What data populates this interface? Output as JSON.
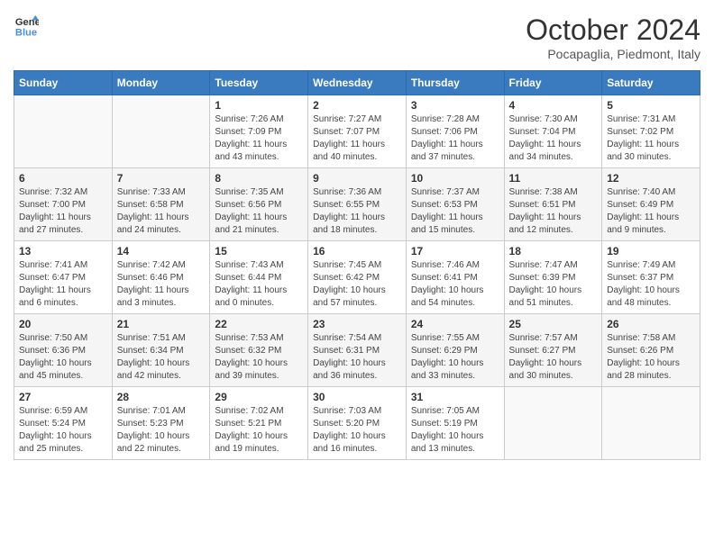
{
  "header": {
    "logo": {
      "line1": "General",
      "line2": "Blue"
    },
    "title": "October 2024",
    "location": "Pocapaglia, Piedmont, Italy"
  },
  "days_of_week": [
    "Sunday",
    "Monday",
    "Tuesday",
    "Wednesday",
    "Thursday",
    "Friday",
    "Saturday"
  ],
  "weeks": [
    [
      {
        "day": "",
        "sunrise": "",
        "sunset": "",
        "daylight": ""
      },
      {
        "day": "",
        "sunrise": "",
        "sunset": "",
        "daylight": ""
      },
      {
        "day": "1",
        "sunrise": "Sunrise: 7:26 AM",
        "sunset": "Sunset: 7:09 PM",
        "daylight": "Daylight: 11 hours and 43 minutes."
      },
      {
        "day": "2",
        "sunrise": "Sunrise: 7:27 AM",
        "sunset": "Sunset: 7:07 PM",
        "daylight": "Daylight: 11 hours and 40 minutes."
      },
      {
        "day": "3",
        "sunrise": "Sunrise: 7:28 AM",
        "sunset": "Sunset: 7:06 PM",
        "daylight": "Daylight: 11 hours and 37 minutes."
      },
      {
        "day": "4",
        "sunrise": "Sunrise: 7:30 AM",
        "sunset": "Sunset: 7:04 PM",
        "daylight": "Daylight: 11 hours and 34 minutes."
      },
      {
        "day": "5",
        "sunrise": "Sunrise: 7:31 AM",
        "sunset": "Sunset: 7:02 PM",
        "daylight": "Daylight: 11 hours and 30 minutes."
      }
    ],
    [
      {
        "day": "6",
        "sunrise": "Sunrise: 7:32 AM",
        "sunset": "Sunset: 7:00 PM",
        "daylight": "Daylight: 11 hours and 27 minutes."
      },
      {
        "day": "7",
        "sunrise": "Sunrise: 7:33 AM",
        "sunset": "Sunset: 6:58 PM",
        "daylight": "Daylight: 11 hours and 24 minutes."
      },
      {
        "day": "8",
        "sunrise": "Sunrise: 7:35 AM",
        "sunset": "Sunset: 6:56 PM",
        "daylight": "Daylight: 11 hours and 21 minutes."
      },
      {
        "day": "9",
        "sunrise": "Sunrise: 7:36 AM",
        "sunset": "Sunset: 6:55 PM",
        "daylight": "Daylight: 11 hours and 18 minutes."
      },
      {
        "day": "10",
        "sunrise": "Sunrise: 7:37 AM",
        "sunset": "Sunset: 6:53 PM",
        "daylight": "Daylight: 11 hours and 15 minutes."
      },
      {
        "day": "11",
        "sunrise": "Sunrise: 7:38 AM",
        "sunset": "Sunset: 6:51 PM",
        "daylight": "Daylight: 11 hours and 12 minutes."
      },
      {
        "day": "12",
        "sunrise": "Sunrise: 7:40 AM",
        "sunset": "Sunset: 6:49 PM",
        "daylight": "Daylight: 11 hours and 9 minutes."
      }
    ],
    [
      {
        "day": "13",
        "sunrise": "Sunrise: 7:41 AM",
        "sunset": "Sunset: 6:47 PM",
        "daylight": "Daylight: 11 hours and 6 minutes."
      },
      {
        "day": "14",
        "sunrise": "Sunrise: 7:42 AM",
        "sunset": "Sunset: 6:46 PM",
        "daylight": "Daylight: 11 hours and 3 minutes."
      },
      {
        "day": "15",
        "sunrise": "Sunrise: 7:43 AM",
        "sunset": "Sunset: 6:44 PM",
        "daylight": "Daylight: 11 hours and 0 minutes."
      },
      {
        "day": "16",
        "sunrise": "Sunrise: 7:45 AM",
        "sunset": "Sunset: 6:42 PM",
        "daylight": "Daylight: 10 hours and 57 minutes."
      },
      {
        "day": "17",
        "sunrise": "Sunrise: 7:46 AM",
        "sunset": "Sunset: 6:41 PM",
        "daylight": "Daylight: 10 hours and 54 minutes."
      },
      {
        "day": "18",
        "sunrise": "Sunrise: 7:47 AM",
        "sunset": "Sunset: 6:39 PM",
        "daylight": "Daylight: 10 hours and 51 minutes."
      },
      {
        "day": "19",
        "sunrise": "Sunrise: 7:49 AM",
        "sunset": "Sunset: 6:37 PM",
        "daylight": "Daylight: 10 hours and 48 minutes."
      }
    ],
    [
      {
        "day": "20",
        "sunrise": "Sunrise: 7:50 AM",
        "sunset": "Sunset: 6:36 PM",
        "daylight": "Daylight: 10 hours and 45 minutes."
      },
      {
        "day": "21",
        "sunrise": "Sunrise: 7:51 AM",
        "sunset": "Sunset: 6:34 PM",
        "daylight": "Daylight: 10 hours and 42 minutes."
      },
      {
        "day": "22",
        "sunrise": "Sunrise: 7:53 AM",
        "sunset": "Sunset: 6:32 PM",
        "daylight": "Daylight: 10 hours and 39 minutes."
      },
      {
        "day": "23",
        "sunrise": "Sunrise: 7:54 AM",
        "sunset": "Sunset: 6:31 PM",
        "daylight": "Daylight: 10 hours and 36 minutes."
      },
      {
        "day": "24",
        "sunrise": "Sunrise: 7:55 AM",
        "sunset": "Sunset: 6:29 PM",
        "daylight": "Daylight: 10 hours and 33 minutes."
      },
      {
        "day": "25",
        "sunrise": "Sunrise: 7:57 AM",
        "sunset": "Sunset: 6:27 PM",
        "daylight": "Daylight: 10 hours and 30 minutes."
      },
      {
        "day": "26",
        "sunrise": "Sunrise: 7:58 AM",
        "sunset": "Sunset: 6:26 PM",
        "daylight": "Daylight: 10 hours and 28 minutes."
      }
    ],
    [
      {
        "day": "27",
        "sunrise": "Sunrise: 6:59 AM",
        "sunset": "Sunset: 5:24 PM",
        "daylight": "Daylight: 10 hours and 25 minutes."
      },
      {
        "day": "28",
        "sunrise": "Sunrise: 7:01 AM",
        "sunset": "Sunset: 5:23 PM",
        "daylight": "Daylight: 10 hours and 22 minutes."
      },
      {
        "day": "29",
        "sunrise": "Sunrise: 7:02 AM",
        "sunset": "Sunset: 5:21 PM",
        "daylight": "Daylight: 10 hours and 19 minutes."
      },
      {
        "day": "30",
        "sunrise": "Sunrise: 7:03 AM",
        "sunset": "Sunset: 5:20 PM",
        "daylight": "Daylight: 10 hours and 16 minutes."
      },
      {
        "day": "31",
        "sunrise": "Sunrise: 7:05 AM",
        "sunset": "Sunset: 5:19 PM",
        "daylight": "Daylight: 10 hours and 13 minutes."
      },
      {
        "day": "",
        "sunrise": "",
        "sunset": "",
        "daylight": ""
      },
      {
        "day": "",
        "sunrise": "",
        "sunset": "",
        "daylight": ""
      }
    ]
  ]
}
